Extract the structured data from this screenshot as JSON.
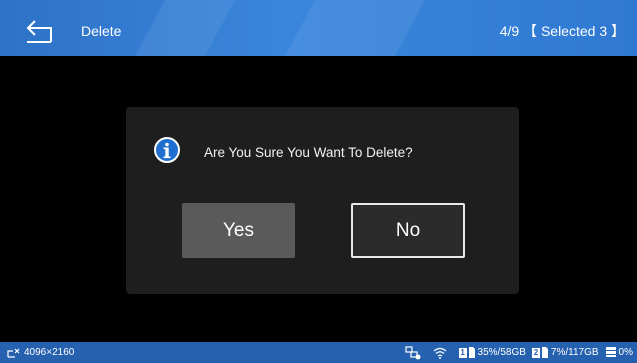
{
  "header": {
    "title": "Delete",
    "counter": "4/9 【 Selected 3 】"
  },
  "dialog": {
    "message": "Are You Sure You Want To Delete?",
    "yes_label": "Yes",
    "no_label": "No"
  },
  "statusbar": {
    "resolution": "4096×2160",
    "card1_num": "1",
    "card1_usage": "35%/58GB",
    "card2_num": "2",
    "card2_usage": "7%/117GB",
    "disk_usage": "0%"
  },
  "colors": {
    "topbar": "#3a86dc",
    "statusbar": "#2661b0",
    "dialog_bg": "#1e1e1e",
    "yes_button": "#5a5a5a",
    "no_button_border": "#e9e9e9"
  },
  "icons": [
    "back-arrow-icon",
    "info-icon",
    "resolution-icon",
    "network-icon",
    "wifi-icon",
    "sd-card-icon",
    "disk-icon"
  ]
}
